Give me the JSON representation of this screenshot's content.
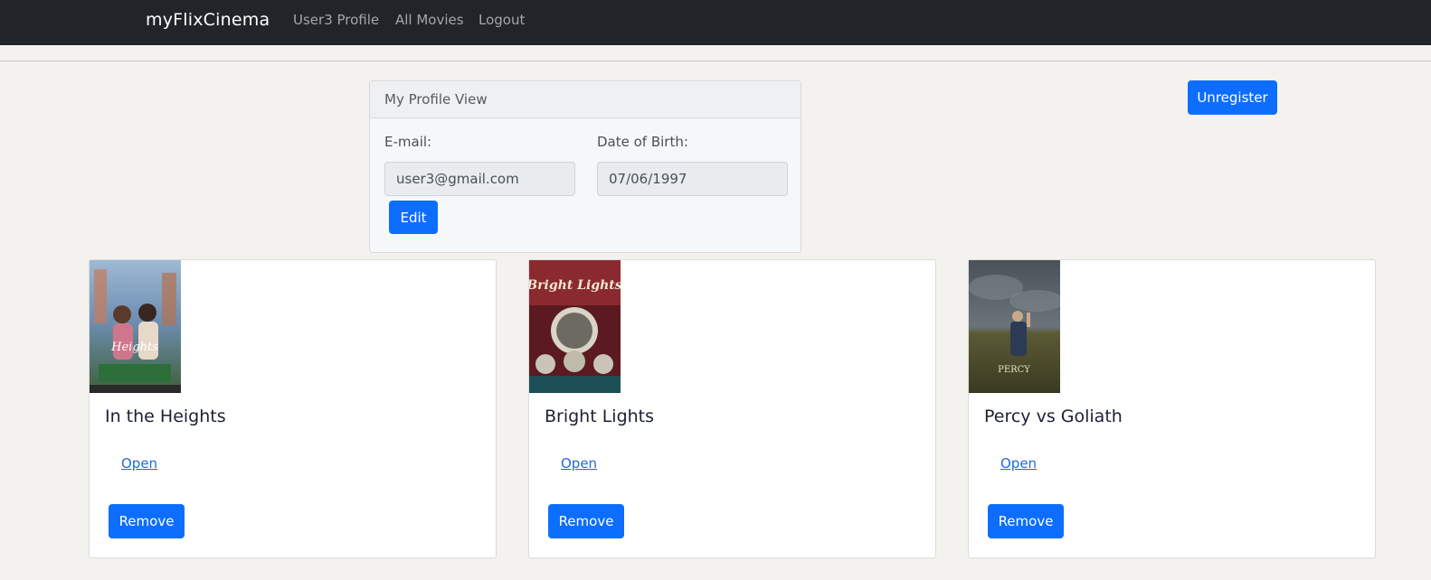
{
  "navbar": {
    "brand": "myFlixCinema",
    "links": [
      {
        "label": "User3 Profile"
      },
      {
        "label": "All Movies"
      },
      {
        "label": "Logout"
      }
    ]
  },
  "profile": {
    "header": "My Profile View",
    "email_label": "E-mail:",
    "email_value": "user3@gmail.com",
    "dob_label": "Date of Birth:",
    "dob_value": "07/06/1997",
    "edit_label": "Edit"
  },
  "unregister_label": "Unregister",
  "movies": [
    {
      "title": "In the Heights",
      "open_label": "Open",
      "remove_label": "Remove",
      "poster_text": "In the Heights"
    },
    {
      "title": "Bright Lights",
      "open_label": "Open",
      "remove_label": "Remove",
      "poster_text": "BRIGHT LIGHTS"
    },
    {
      "title": "Percy vs Goliath",
      "open_label": "Open",
      "remove_label": "Remove",
      "poster_text": "PERCY"
    }
  ],
  "colors": {
    "navbar": "#212529",
    "page_bg": "#f4f2ee",
    "primary": "#0d6efd"
  }
}
